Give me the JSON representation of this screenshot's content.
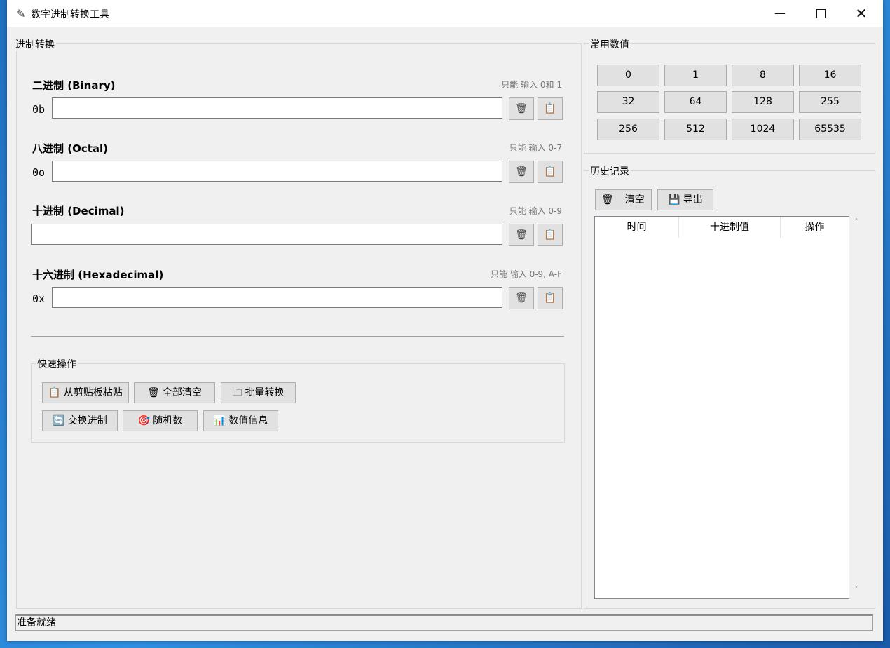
{
  "window": {
    "title": "数字进制转换工具",
    "min_glyph": "—",
    "close_glyph": "✕"
  },
  "conversion": {
    "legend": "进制转换",
    "fields": [
      {
        "title": "二进制 (Binary)",
        "hint": "只能 输入 0和 1",
        "prefix": "0b",
        "value": ""
      },
      {
        "title": "八进制 (Octal)",
        "hint": "只能 输入 0-7",
        "prefix": "0o",
        "value": ""
      },
      {
        "title": "十进制 (Decimal)",
        "hint": "只能 输入 0-9",
        "prefix": "",
        "value": ""
      },
      {
        "title": "十六进制 (Hexadecimal)",
        "hint": "只能 输入 0-9, A-F",
        "prefix": "0x",
        "value": ""
      }
    ],
    "clear_icon": "🗑",
    "copy_icon": "📋"
  },
  "quick_ops": {
    "legend": "快速操作",
    "buttons": [
      {
        "icon": "📋",
        "label": "从剪贴板粘贴"
      },
      {
        "icon": "🗑",
        "label": "全部清空"
      },
      {
        "icon": "🗀",
        "label": "批量转换"
      },
      {
        "icon": "🔄",
        "label": "交换进制"
      },
      {
        "icon": "🎯",
        "label": "随机数"
      },
      {
        "icon": "📊",
        "label": "数值信息"
      }
    ]
  },
  "common_values": {
    "legend": "常用数值",
    "values": [
      "0",
      "1",
      "8",
      "16",
      "32",
      "64",
      "128",
      "255",
      "256",
      "512",
      "1024",
      "65535"
    ]
  },
  "history": {
    "legend": "历史记录",
    "clear": {
      "icon": "🗑",
      "label": "清空"
    },
    "export": {
      "icon": "💾",
      "label": "导出"
    },
    "columns": [
      "时间",
      "十进制值",
      "操作"
    ],
    "scroll_up": "˄",
    "scroll_down": "˅"
  },
  "status": "准备就绪"
}
